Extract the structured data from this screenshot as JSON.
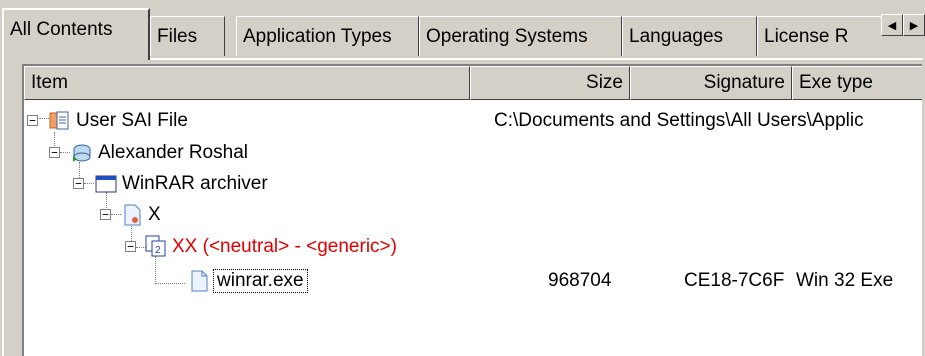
{
  "tabs": [
    {
      "label": "All Contents",
      "active": true
    },
    {
      "label": "Files",
      "active": false
    },
    {
      "label": "Application Types",
      "active": false
    },
    {
      "label": "Operating Systems",
      "active": false
    },
    {
      "label": "Languages",
      "active": false
    },
    {
      "label": "License R",
      "active": false
    }
  ],
  "scroll": {
    "left": "◀",
    "right": "▶"
  },
  "columns": {
    "item": "Item",
    "size": "Size",
    "signature": "Signature",
    "exe_type": "Exe type"
  },
  "tree": {
    "root": {
      "label": "User SAI File",
      "path": "C:\\Documents and Settings\\All Users\\Applic",
      "icon": "sai-file-icon"
    },
    "vendor": {
      "label": "Alexander Roshal",
      "icon": "vendor-icon"
    },
    "product": {
      "label": "WinRAR archiver",
      "icon": "application-window-icon"
    },
    "version": {
      "label": "X",
      "icon": "version-file-icon"
    },
    "subversion": {
      "label": "XX (<neutral> - <generic>)",
      "icon": "language-file-icon",
      "color": "#e00000"
    },
    "file": {
      "label": "winrar.exe",
      "size": "968704",
      "signature": "CE18-7C6F",
      "exe_type": "Win 32 Exe",
      "icon": "document-icon"
    }
  },
  "expander_symbol": "−"
}
